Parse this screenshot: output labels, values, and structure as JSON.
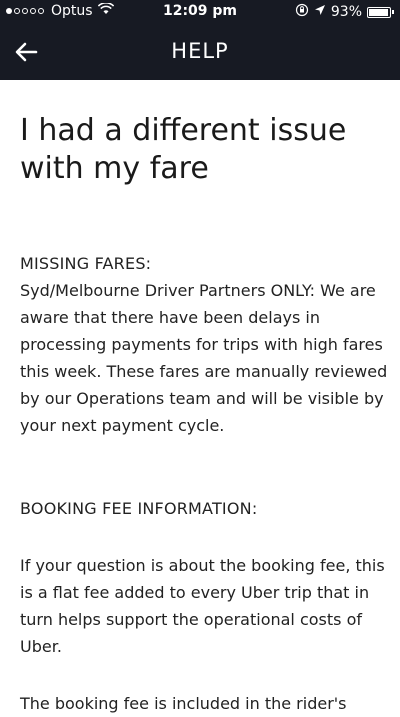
{
  "status_bar": {
    "carrier": "Optus",
    "signal_bars_filled": 1,
    "signal_bars_total": 5,
    "time": "12:09 pm",
    "battery_percent": "93%",
    "battery_level": 0.93
  },
  "nav": {
    "title": "HELP",
    "back_icon": "arrow-left-icon"
  },
  "main": {
    "title": "I had a different issue with my fare",
    "missing_fares_heading": "MISSING FARES:",
    "missing_fares_body": "Syd/Melbourne Driver Partners ONLY: We are aware that there have been delays in processing payments for trips with high fares this week. These fares are manually reviewed by our Operations team and will be visible by your next payment cycle.",
    "booking_fee_heading": "BOOKING FEE INFORMATION:",
    "booking_fee_body": "If your question is about the booking fee, this is a flat fee added to every Uber trip that in turn helps support the operational costs of Uber.",
    "next_paragraph_partial": "The booking fee is included in the rider's"
  },
  "colors": {
    "header_bg": "#171a23",
    "text": "#222222",
    "background": "#ffffff"
  }
}
